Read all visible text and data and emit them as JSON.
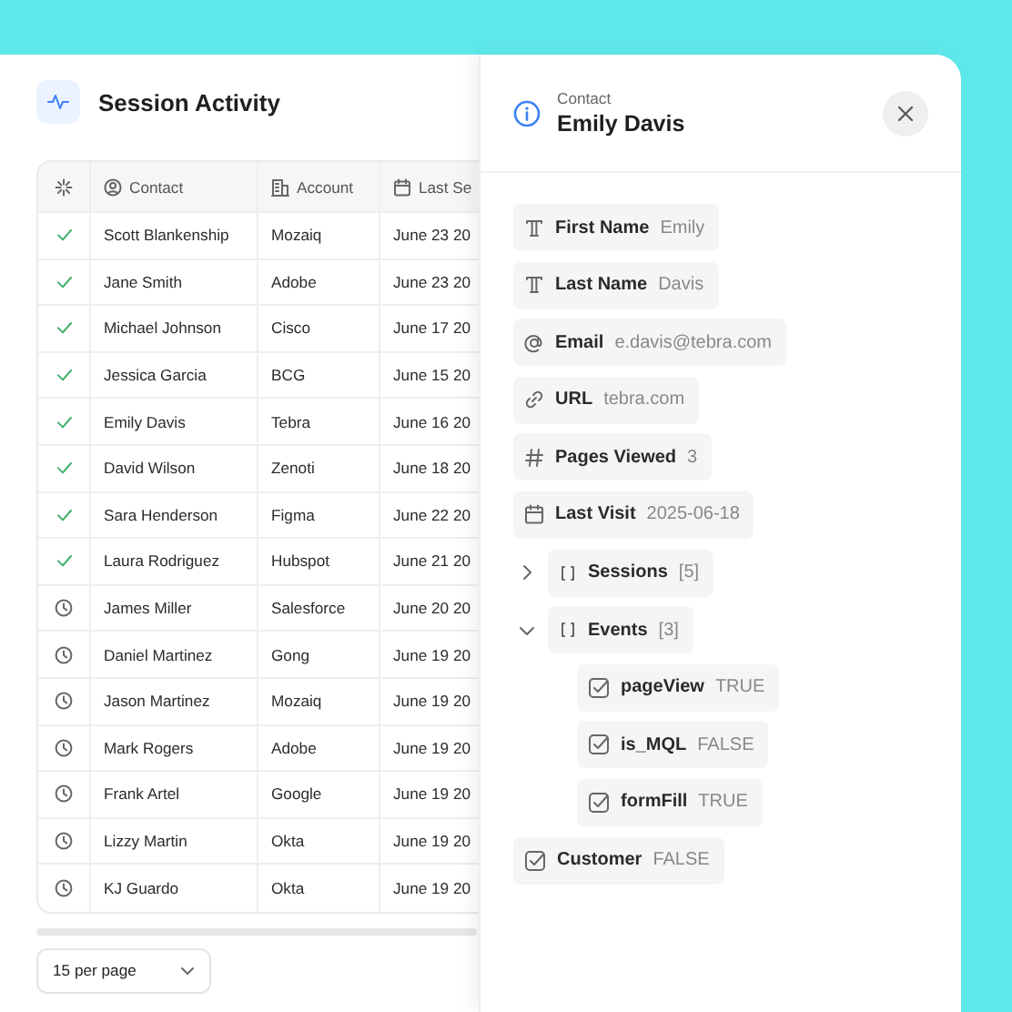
{
  "page": {
    "title": "Session Activity"
  },
  "table": {
    "columns": [
      {
        "label": "Contact",
        "kind": "person"
      },
      {
        "label": "Account",
        "kind": "building"
      },
      {
        "label": "Last Se",
        "kind": "calendar"
      }
    ],
    "rows": [
      {
        "completed": true,
        "contact": "Scott Blankenship",
        "account": "Mozaiq",
        "last_session": "June 23 20"
      },
      {
        "completed": true,
        "contact": "Jane Smith",
        "account": "Adobe",
        "last_session": "June 23 20"
      },
      {
        "completed": true,
        "contact": "Michael Johnson",
        "account": "Cisco",
        "last_session": "June 17 20"
      },
      {
        "completed": true,
        "contact": "Jessica Garcia",
        "account": "BCG",
        "last_session": "June 15 20"
      },
      {
        "completed": true,
        "contact": "Emily Davis",
        "account": "Tebra",
        "last_session": "June 16 20"
      },
      {
        "completed": true,
        "contact": "David Wilson",
        "account": "Zenoti",
        "last_session": "June 18 20"
      },
      {
        "completed": true,
        "contact": "Sara Henderson",
        "account": "Figma",
        "last_session": "June 22 20"
      },
      {
        "completed": true,
        "contact": "Laura Rodriguez",
        "account": "Hubspot",
        "last_session": "June 21 20"
      },
      {
        "completed": false,
        "contact": "James Miller",
        "account": "Salesforce",
        "last_session": "June 20 20"
      },
      {
        "completed": false,
        "contact": "Daniel Martinez",
        "account": "Gong",
        "last_session": "June 19 20"
      },
      {
        "completed": false,
        "contact": "Jason Martinez",
        "account": "Mozaiq",
        "last_session": "June 19 20"
      },
      {
        "completed": false,
        "contact": "Mark Rogers",
        "account": "Adobe",
        "last_session": "June 19 20"
      },
      {
        "completed": false,
        "contact": "Frank Artel",
        "account": "Google",
        "last_session": "June 19 20"
      },
      {
        "completed": false,
        "contact": "Lizzy Martin",
        "account": "Okta",
        "last_session": "June 19 20"
      },
      {
        "completed": false,
        "contact": "KJ Guardo",
        "account": "Okta",
        "last_session": "June 19 20"
      }
    ]
  },
  "pagination": {
    "per_page": "15 per page"
  },
  "panel": {
    "subtitle": "Contact",
    "title": "Emily Davis",
    "fields": [
      {
        "kind": "text",
        "label": "First Name",
        "value": "Emily"
      },
      {
        "kind": "text",
        "label": "Last Name",
        "value": "Davis"
      },
      {
        "kind": "email",
        "label": "Email",
        "value": "e.davis@tebra.com"
      },
      {
        "kind": "url",
        "label": "URL",
        "value": "tebra.com"
      },
      {
        "kind": "number",
        "label": "Pages Viewed",
        "value": "3"
      },
      {
        "kind": "date",
        "label": "Last Visit",
        "value": "2025-06-18"
      },
      {
        "kind": "list",
        "label": "Sessions",
        "value": "[5]",
        "expanded": false
      },
      {
        "kind": "list",
        "label": "Events",
        "value": "[3]",
        "expanded": true,
        "children": [
          {
            "kind": "boolean",
            "label": "pageView",
            "value": "TRUE"
          },
          {
            "kind": "boolean",
            "label": "is_MQL",
            "value": "FALSE"
          },
          {
            "kind": "boolean",
            "label": "formFill",
            "value": "TRUE"
          }
        ]
      },
      {
        "kind": "boolean",
        "label": "Customer",
        "value": "FALSE"
      }
    ]
  }
}
